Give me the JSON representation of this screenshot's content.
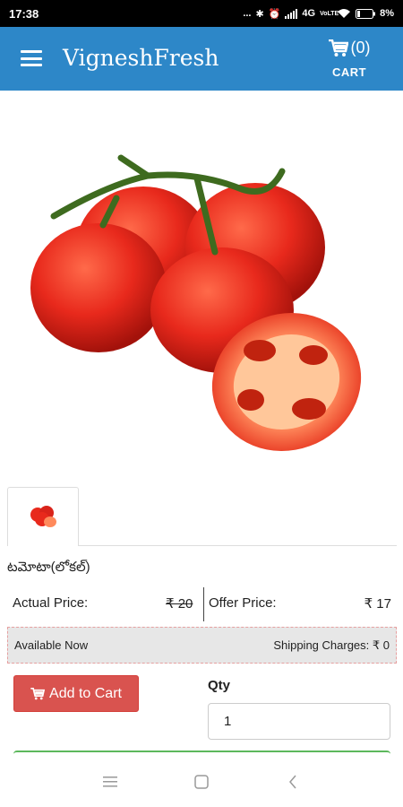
{
  "status_bar": {
    "time": "17:38",
    "dots": "...",
    "network": "4G",
    "volte": "VoLTE",
    "battery": "8%"
  },
  "header": {
    "brand": "VigneshFresh",
    "cart_count": "(0)",
    "cart_label": "CART",
    "color": "#2d87c8"
  },
  "product": {
    "name": "టమోటా(లోకల్)",
    "actual_price_label": "Actual Price:",
    "actual_price": "₹ 20",
    "offer_price_label": "Offer Price:",
    "offer_price": "₹ 17",
    "availability": "Available Now",
    "shipping": "Shipping Charges: ₹ 0"
  },
  "actions": {
    "add_to_cart": "Add to Cart",
    "qty_label": "Qty",
    "qty_value": "1"
  },
  "icons": [
    "menu-icon",
    "cart-icon",
    "nav-menu-icon",
    "nav-home-icon",
    "nav-back-icon"
  ]
}
